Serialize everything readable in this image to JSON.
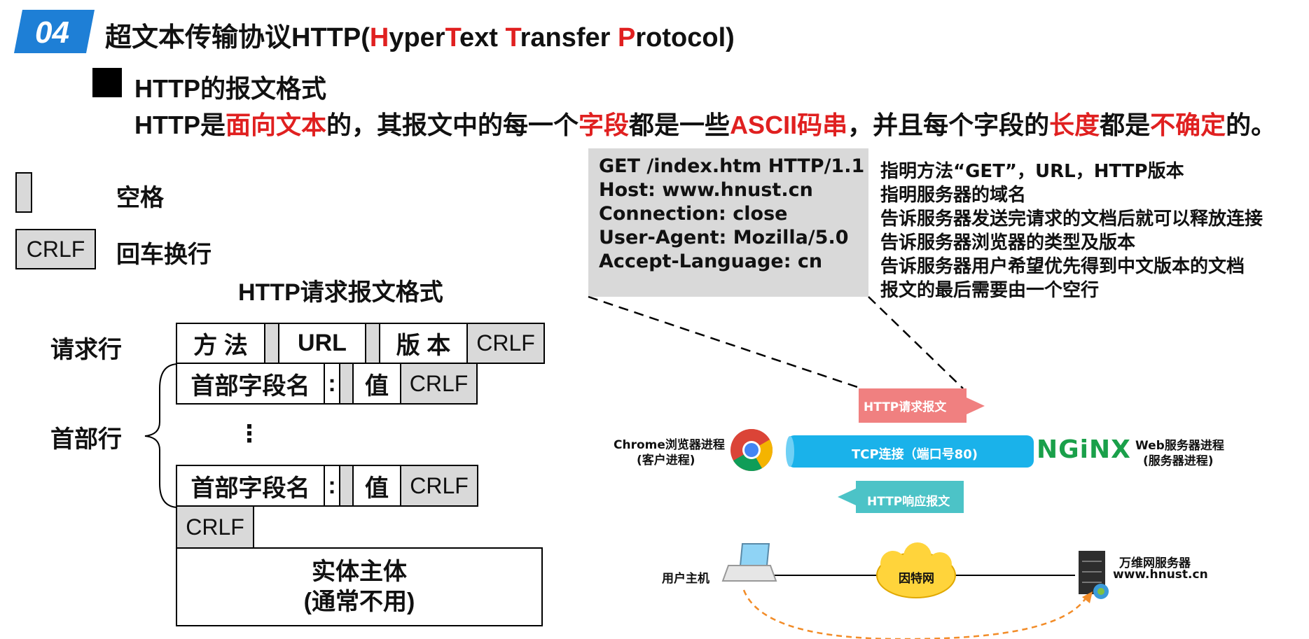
{
  "header": {
    "badge": "04",
    "title_prefix": "超文本传输协议HTTP(",
    "title_h": "H",
    "title_yper": "yper",
    "title_t": "T",
    "title_ext": "ext ",
    "title_t2": "T",
    "title_ransfer": "ransfer ",
    "title_p": "P",
    "title_rotocol": "rotocol)"
  },
  "subtitle": "HTTP的报文格式",
  "description": {
    "p1": "HTTP是",
    "h1": "面向文本",
    "p2": "的，其报文中的每一个",
    "h2": "字段",
    "p3": "都是一些",
    "h3": "ASCII码串",
    "p4": "，并且每个字段的",
    "h4": "长度",
    "p5": "都是",
    "h5": "不确定",
    "p6": "的。"
  },
  "legend": {
    "space_label": "空格",
    "crlf_box": "CRLF",
    "crlf_label": "回车换行"
  },
  "format": {
    "title": "HTTP请求报文格式",
    "request_line_label": "请求行",
    "header_line_label": "首部行",
    "method": "方 法",
    "url": "URL",
    "version": "版 本",
    "crlf": "CRLF",
    "field_name": "首部字段名",
    "colon": ":",
    "value": "值",
    "ellipsis": "⋮",
    "body_line1": "实体主体",
    "body_line2": "(通常不用)"
  },
  "example": {
    "lines": [
      "GET /index.htm HTTP/1.1",
      "Host: www.hnust.cn",
      "Connection: close",
      "User-Agent: Mozilla/5.0",
      "Accept-Language: cn"
    ],
    "notes": [
      "指明方法“GET”，URL，HTTP版本",
      "指明服务器的域名",
      "告诉服务器发送完请求的文档后就可以释放连接",
      "告诉服务器浏览器的类型及版本",
      "告诉服务器用户希望优先得到中文版本的文档",
      "报文的最后需要由一个空行"
    ]
  },
  "network": {
    "request_arrow": "HTTP请求报文",
    "response_arrow": "HTTP响应报文",
    "tcp": "TCP连接（端口号80)",
    "client_line1": "Chrome浏览器进程",
    "client_line2": "(客户进程)",
    "nginx": "NGiNX",
    "server_line1": "Web服务器进程",
    "server_line2": "(服务器进程)",
    "user_host": "用户主机",
    "internet": "因特网",
    "www_server_line1": "万维网服务器",
    "www_server_line2": "www.hnust.cn"
  },
  "colors": {
    "badge": "#1e7fd6",
    "highlight": "#e02020",
    "request": "#f08080",
    "response": "#4cc3c7",
    "tcp": "#1ab2ea",
    "nginx": "#1aa04a"
  }
}
